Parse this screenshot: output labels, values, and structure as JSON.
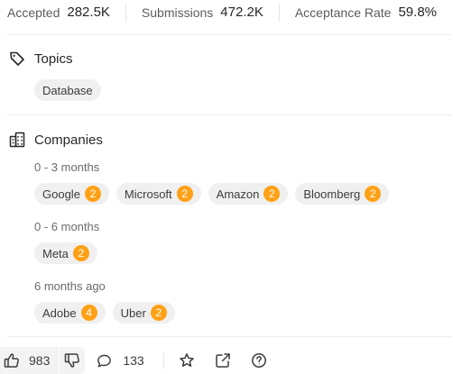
{
  "stats": {
    "accepted_label": "Accepted",
    "accepted_value": "282.5K",
    "submissions_label": "Submissions",
    "submissions_value": "472.2K",
    "acceptance_label": "Acceptance Rate",
    "acceptance_value": "59.8%"
  },
  "topics": {
    "title": "Topics",
    "icon": "tag-icon",
    "tags": [
      "Database"
    ]
  },
  "companies": {
    "title": "Companies",
    "icon": "building-icon",
    "groups": [
      {
        "label": "0 - 3 months",
        "items": [
          {
            "name": "Google",
            "count": "2"
          },
          {
            "name": "Microsoft",
            "count": "2"
          },
          {
            "name": "Amazon",
            "count": "2"
          },
          {
            "name": "Bloomberg",
            "count": "2"
          }
        ]
      },
      {
        "label": "0 - 6 months",
        "items": [
          {
            "name": "Meta",
            "count": "2"
          }
        ]
      },
      {
        "label": "6 months ago",
        "items": [
          {
            "name": "Adobe",
            "count": "4"
          },
          {
            "name": "Uber",
            "count": "2"
          }
        ]
      }
    ]
  },
  "actions": {
    "upvotes": "983",
    "comments": "133",
    "icons": [
      "thumbs-up-icon",
      "thumbs-down-icon",
      "comment-icon",
      "star-icon",
      "share-icon",
      "help-icon"
    ]
  },
  "colors": {
    "badge": "#ffa116",
    "tag_bg": "#f0f0f0"
  }
}
